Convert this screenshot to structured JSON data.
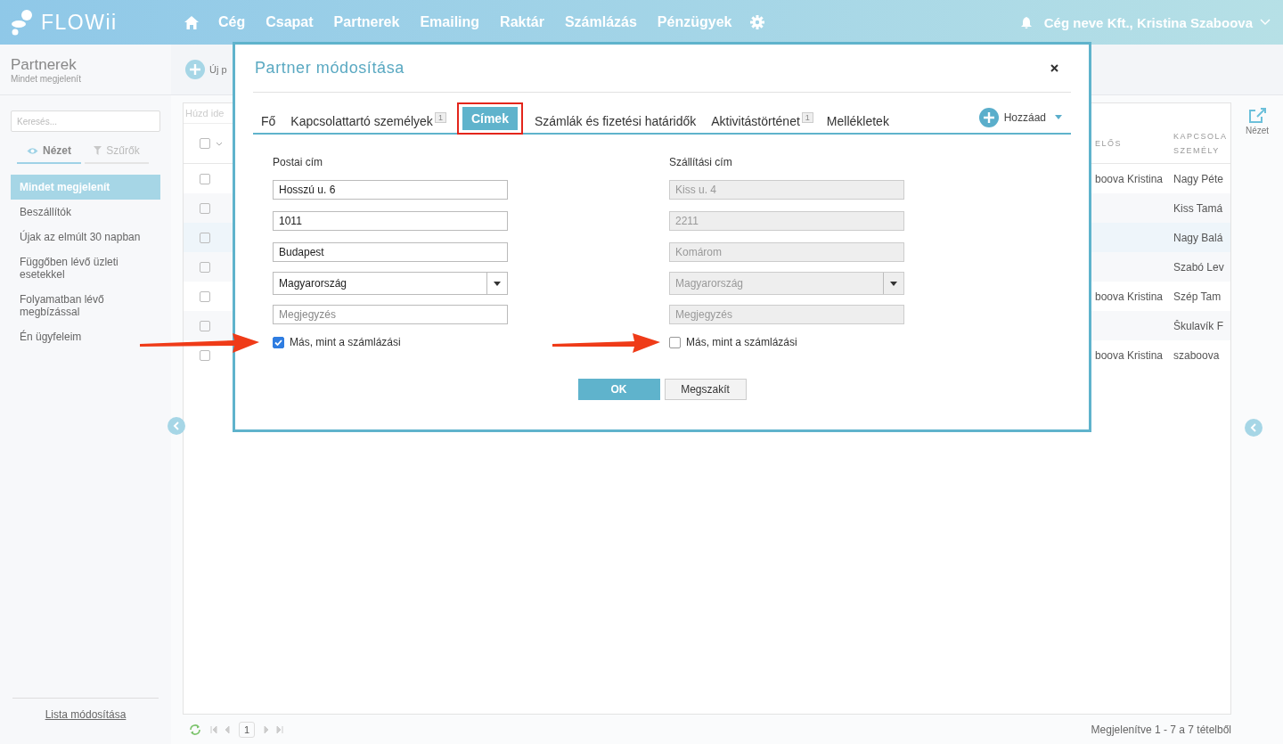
{
  "nav": {
    "logo": "FLOWii",
    "items": [
      "Cég",
      "Csapat",
      "Partnerek",
      "Emailing",
      "Raktár",
      "Számlázás",
      "Pénzügyek"
    ],
    "user": "Cég neve Kft., Kristina Szaboova"
  },
  "sidebar": {
    "title": "Partnerek",
    "subtitle": "Mindet megjelenít",
    "search": {
      "placeholder": "Keresés..."
    },
    "view_tabs": [
      {
        "label": "Nézet",
        "selected": true
      },
      {
        "label": "Szűrők",
        "selected": false
      }
    ],
    "items": [
      {
        "label": "Mindet megjelenít",
        "selected": true
      },
      {
        "label": "Beszállítók",
        "selected": false
      },
      {
        "label": "Újak az elmúlt 30 napban",
        "selected": false
      },
      {
        "label": "Függőben lévő üzleti esetekkel",
        "selected": false
      },
      {
        "label": "Folyamatban lévő megbízással",
        "selected": false
      },
      {
        "label": "Én ügyfeleim",
        "selected": false
      }
    ],
    "footer_link": "Lista módosítása"
  },
  "toolbar": {
    "new_button": "Új p"
  },
  "table": {
    "group_hint": "Húzd ide",
    "select_all": {
      "checked": false
    },
    "columns": [
      "ELŐS",
      "KAPCSOLA SZEMÉLY"
    ],
    "rows": [
      {
        "checked": false,
        "owner": "boova Kristina",
        "contact": "Nagy Péte"
      },
      {
        "checked": false,
        "contact": "Kiss Tamá"
      },
      {
        "checked": false,
        "contact": "Nagy Balá"
      },
      {
        "checked": false,
        "contact": "Szabó Lev"
      },
      {
        "checked": false,
        "owner": "boova Kristina",
        "contact": "Szép Tam"
      },
      {
        "checked": false,
        "contact": "Škulavík F"
      },
      {
        "checked": false,
        "owner": "boova Kristina",
        "contact": "szaboova"
      }
    ]
  },
  "pager": {
    "page": "1",
    "summary": "Megjelenítve 1 - 7 a 7 tételből"
  },
  "right_panel": {
    "label": "Nézet"
  },
  "modal": {
    "title": "Partner módosítása",
    "tabs": [
      {
        "label": "Fő",
        "selected": false
      },
      {
        "label": "Kapcsolattartó személyek",
        "badge": "1",
        "selected": false
      },
      {
        "label": "Címek",
        "selected": true
      },
      {
        "label": "Számlák és fizetési határidők",
        "selected": false
      },
      {
        "label": "Aktivitástörténet",
        "badge": "1",
        "selected": false
      },
      {
        "label": "Mellékletek",
        "selected": false
      }
    ],
    "add_button": "Hozzáad",
    "columns": [
      {
        "heading": "Postai cím",
        "disabled": false,
        "fields": [
          {
            "kind": "text",
            "value": "Hosszú u. 6"
          },
          {
            "kind": "text",
            "value": "1011"
          },
          {
            "kind": "text",
            "value": "Budapest"
          },
          {
            "kind": "select",
            "value": "Magyarország"
          },
          {
            "kind": "text",
            "placeholder": "Megjegyzés"
          }
        ],
        "checkbox": {
          "label": "Más, mint a számlázási",
          "checked": true
        }
      },
      {
        "heading": "Szállítási cím",
        "disabled": true,
        "fields": [
          {
            "kind": "text",
            "value": "Kiss u. 4"
          },
          {
            "kind": "text",
            "value": "2211"
          },
          {
            "kind": "text",
            "value": "Komárom"
          },
          {
            "kind": "select",
            "value": "Magyarország"
          },
          {
            "kind": "text",
            "placeholder": "Megjegyzés"
          }
        ],
        "checkbox": {
          "label": "Más, mint a számlázási",
          "checked": false
        }
      }
    ],
    "buttons": [
      {
        "label": "OK",
        "kind": "primary"
      },
      {
        "label": "Megszakít",
        "kind": "secondary"
      }
    ]
  }
}
